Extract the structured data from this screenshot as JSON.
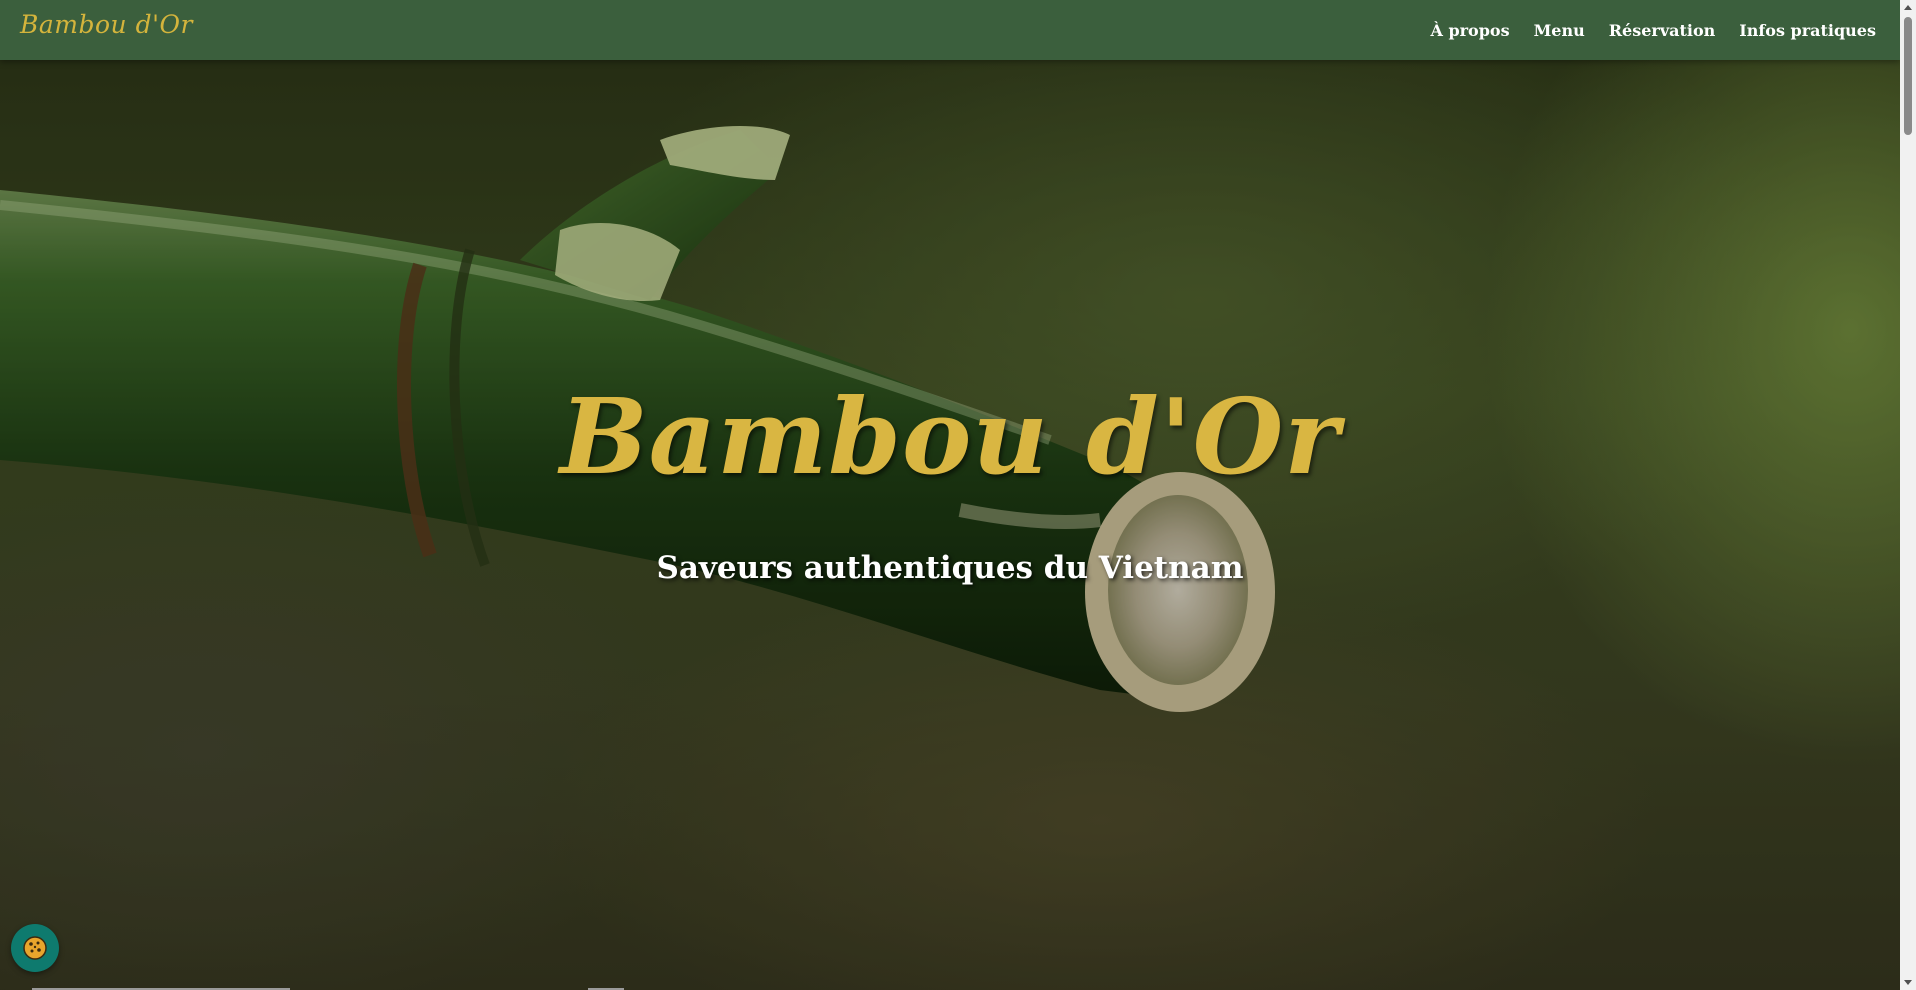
{
  "navbar": {
    "brand": "Bambou d'Or",
    "links": [
      {
        "label": "À propos"
      },
      {
        "label": "Menu"
      },
      {
        "label": "Réservation"
      },
      {
        "label": "Infos pratiques"
      }
    ]
  },
  "hero": {
    "title": "Bambou d'Or",
    "subtitle": "Saveurs authentiques du Vietnam",
    "background_image": "bamboo-stalk-image"
  },
  "cookie_button": {
    "icon": "cookie-icon"
  },
  "colors": {
    "navbar_bg": "#3b5f3d",
    "accent_gold": "#d4b43c",
    "cookie_button_bg": "#0e7a6e"
  }
}
